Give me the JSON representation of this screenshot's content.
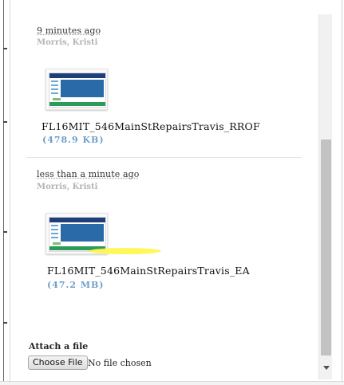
{
  "attachments": [
    {
      "timestamp": "9 minutes ago",
      "author": "Morris, Kristi",
      "filename": "FL16MIT_546MainStRepairsTravis_RROF",
      "filesize": "(478.9 KB)"
    },
    {
      "timestamp": "less than a minute ago",
      "author": "Morris, Kristi",
      "filename": "FL16MIT_546MainStRepairsTravis_EA",
      "filesize": "(47.2 MB)"
    }
  ],
  "attach_form": {
    "label": "Attach a file",
    "button_label": "Choose File",
    "status_text": "No file chosen"
  },
  "scrollbar": {
    "position_fraction": 0.6
  }
}
